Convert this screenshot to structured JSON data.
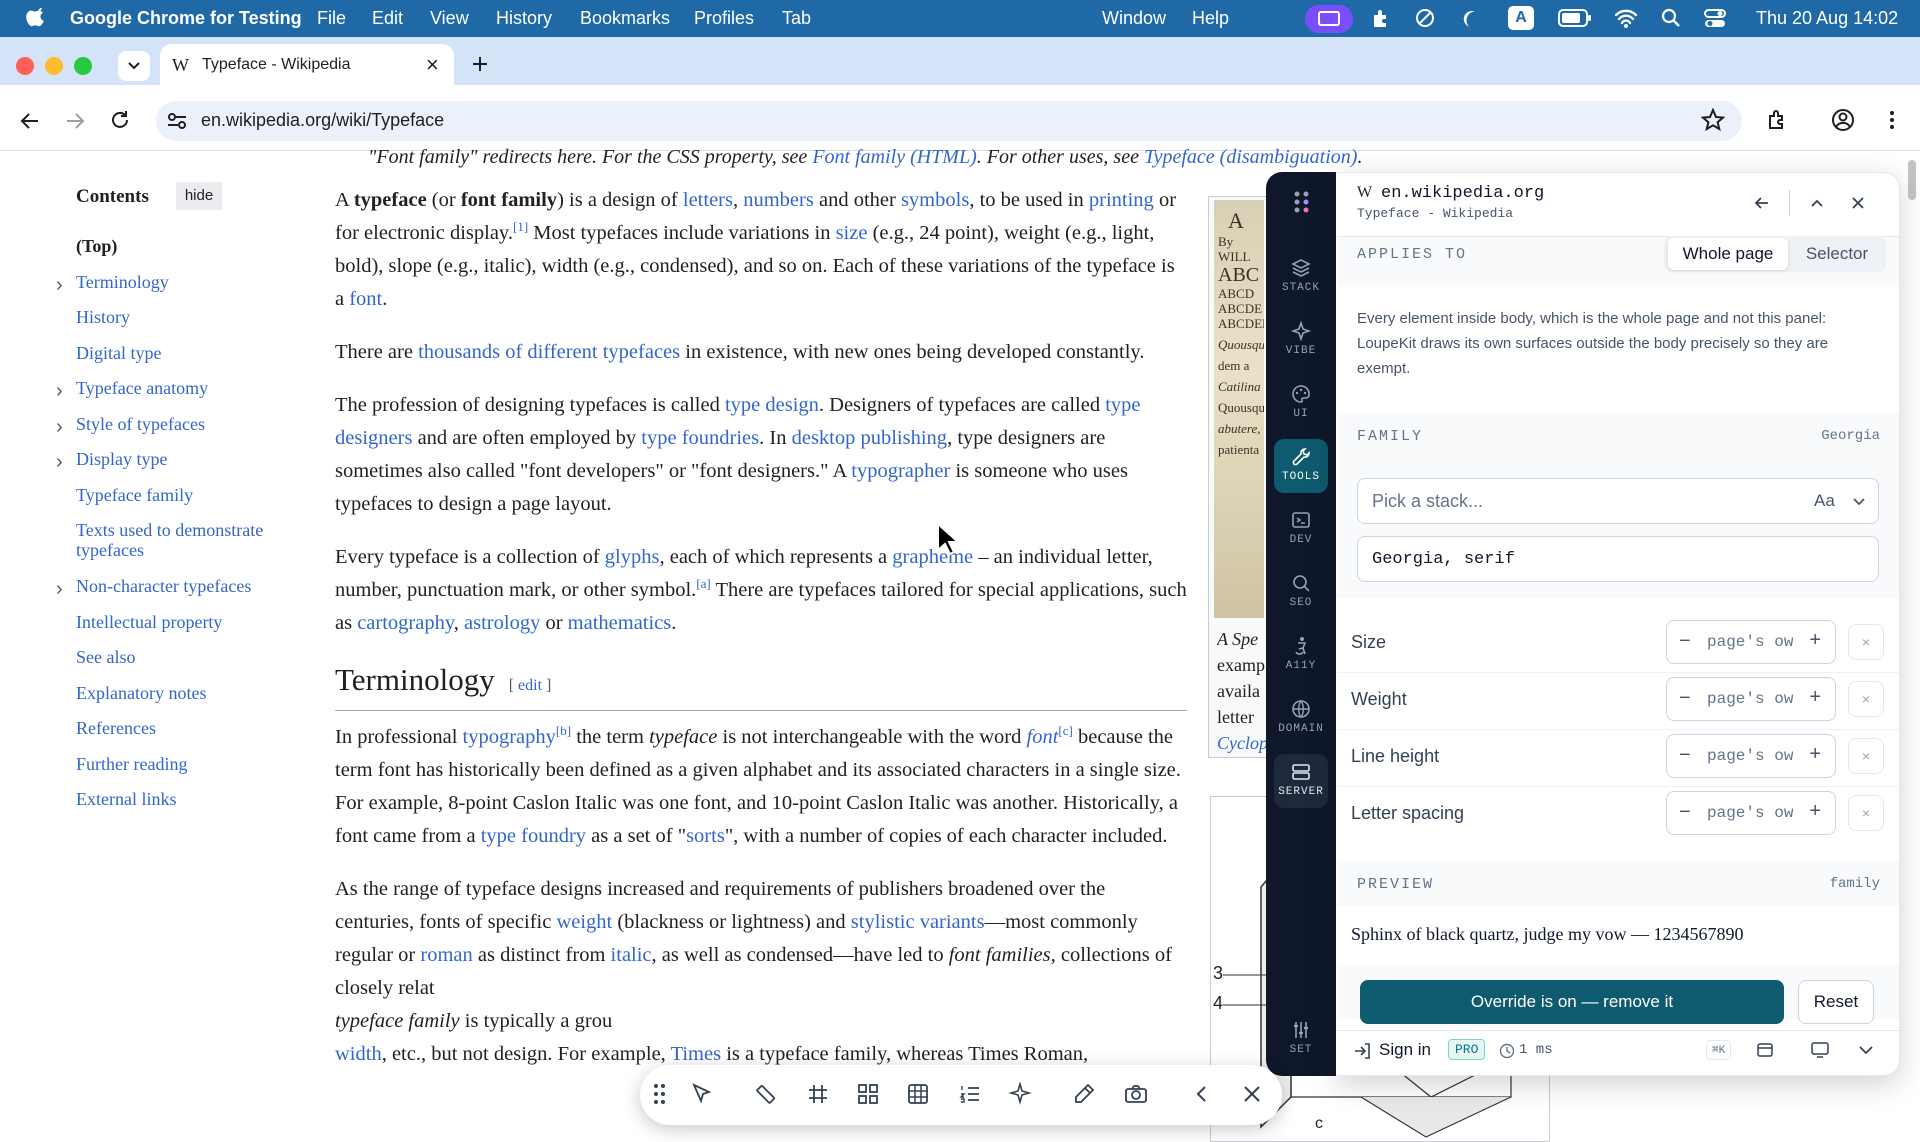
{
  "menubar": {
    "app_name": "Google Chrome for Testing",
    "items": [
      "File",
      "Edit",
      "View",
      "History",
      "Bookmarks",
      "Profiles",
      "Tab",
      "Window",
      "Help"
    ],
    "datetime": "Thu 20 Aug  14:02",
    "status_icons": [
      "screen-mirroring-icon",
      "extension-icon",
      "focus-icon",
      "moon-icon",
      "input-source-icon",
      "battery-icon",
      "wifi-icon",
      "spotlight-icon",
      "control-center-icon"
    ],
    "input_source": "A"
  },
  "tab": {
    "favicon": "W",
    "title": "Typeface - Wikipedia",
    "close": "×"
  },
  "toolbar": {
    "url": "en.wikipedia.org/wiki/Typeface"
  },
  "wiki": {
    "hatnote": {
      "prefix": "\"Font family\" redirects here. For the CSS property, see ",
      "link1": "Font family (HTML)",
      "middle": ". For other uses, see ",
      "link2": "Typeface (disambiguation)",
      "suffix": "."
    },
    "toc": {
      "title": "Contents",
      "hide": "hide",
      "items": [
        {
          "label": "(Top)",
          "top": true
        },
        {
          "label": "Terminology",
          "expand": true
        },
        {
          "label": "History"
        },
        {
          "label": "Digital type"
        },
        {
          "label": "Typeface anatomy",
          "expand": true
        },
        {
          "label": "Style of typefaces",
          "expand": true
        },
        {
          "label": "Display type",
          "expand": true
        },
        {
          "label": "Typeface family"
        },
        {
          "label": "Texts used to demonstrate typefaces"
        },
        {
          "label": "Non-character typefaces",
          "expand": true
        },
        {
          "label": "Intellectual property"
        },
        {
          "label": "See also"
        },
        {
          "label": "Explanatory notes"
        },
        {
          "label": "References"
        },
        {
          "label": "Further reading"
        },
        {
          "label": "External links"
        }
      ]
    },
    "p1": {
      "t1": "A ",
      "b1": "typeface",
      "t2": " (or ",
      "b2": "font family",
      "t3": ") is a design of ",
      "l1": "letters",
      "t4": ", ",
      "l2": "numbers",
      "t5": " and other ",
      "l3": "symbols",
      "t6": ", to be used in ",
      "l4": "printing",
      "t7": " or for electronic display.",
      "s1": "[1]",
      "t8": " Most typefaces include variations in ",
      "l5": "size",
      "t9": " (e.g., 24 point), weight (e.g., light, bold), slope (e.g., italic), width (e.g., condensed), and so on. Each of these variations of the typeface is a ",
      "l6": "font",
      "t10": "."
    },
    "p2": {
      "t1": "There are ",
      "l1": "thousands of different typefaces",
      "t2": " in existence, with new ones being developed constantly."
    },
    "p3": {
      "t1": "The profession of designing typefaces is called ",
      "l1": "type design",
      "t2": ". Designers of typefaces are called ",
      "l2": "type designers",
      "t3": " and are often employed by ",
      "l3": "type foundries",
      "t4": ". In ",
      "l4": "desktop publishing",
      "t5": ", type designers are sometimes also called \"font developers\" or \"font designers.\" A ",
      "l5": "typographer",
      "t6": " is someone who uses typefaces to design a page layout."
    },
    "p4": {
      "t1": "Every typeface is a collection of ",
      "l1": "glyphs",
      "t2": ", each of which represents a ",
      "l2": "grapheme",
      "t3": " – an individual letter, number, punctuation mark, or other symbol.",
      "s1": "[a]",
      "t4": " There are typefaces tailored for special applications, such as ",
      "l3": "cartography",
      "t5": ", ",
      "l4": "astrology",
      "t6": " or ",
      "l5": "mathematics",
      "t7": "."
    },
    "h2": {
      "title": "Terminology",
      "edit_open": "[ ",
      "edit": "edit",
      "edit_close": " ]"
    },
    "p5": {
      "t1": "In professional ",
      "l1": "typography",
      "s1": "[b]",
      "t2": " the term ",
      "i1": "typeface",
      "t3": " is not interchangeable with the word ",
      "l2": "font",
      "s2": "[c]",
      "t4": " because the term font has historically been defined as a given alphabet and its associated characters in a single size. For example, 8-point Caslon Italic was one font, and 10-point Caslon Italic was another. Historically, a font came from a ",
      "l3": "type foundry",
      "t5": " as a set of \"",
      "l4": "sorts",
      "t6": "\", with a number of copies of each character included."
    },
    "p6": {
      "t1": "As the range of typeface designs increased and requirements of publishers broadened over the centuries, fonts of specific ",
      "l1": "weight",
      "t2": " (blackness or lightness) and ",
      "l2": "stylistic variants",
      "t3": "—most commonly regular or ",
      "l3": "roman",
      "t4": " as distinct from ",
      "l4": "italic",
      "t5": ", as well as condensed—have led to ",
      "i1": "font families",
      "t6": ", collections of closely relat",
      "t7": "",
      "i2": "typeface family",
      "t8": " is typically a grou",
      "l5": "width",
      "t9": ", etc., but not design. For example, ",
      "l6": "Times",
      "t10": " is a typeface family, whereas Times Roman,"
    },
    "infobox_caption": [
      "A Spe",
      "examp",
      "availa",
      "letter",
      "Cyclop"
    ],
    "infobox_img_text": [
      "A",
      "By WILL",
      "ABC",
      "ABCD",
      "ABCDE",
      "ABCDEF",
      "Quousque",
      "dem a",
      "Catilina",
      "Quousque",
      "abutere,",
      "patienta"
    ],
    "diagram_labels": [
      "3",
      "4",
      "c"
    ]
  },
  "panel": {
    "rail": [
      {
        "label": "STACK",
        "icon": "stack-icon"
      },
      {
        "label": "VIBE",
        "icon": "sparkle-icon"
      },
      {
        "label": "UI",
        "icon": "palette-icon"
      },
      {
        "label": "TOOLS",
        "icon": "wrench-icon",
        "active": true
      },
      {
        "label": "DEV",
        "icon": "terminal-icon"
      },
      {
        "label": "SEO",
        "icon": "magnifier-icon"
      },
      {
        "label": "A11Y",
        "icon": "accessibility-icon"
      },
      {
        "label": "DOMAIN",
        "icon": "globe-icon"
      },
      {
        "label": "SERVER",
        "icon": "server-icon"
      },
      {
        "label": "SET",
        "icon": "sliders-icon"
      }
    ],
    "header": {
      "favicon": "W",
      "domain": "en.wikipedia.org",
      "title": "Typeface - Wikipedia"
    },
    "applies_to": {
      "label": "APPLIES TO",
      "options": [
        "Whole page",
        "Selector"
      ],
      "selected": "Whole page"
    },
    "description": "Every element inside body, which is the whole page and not this panel: LoupeKit draws its own surfaces outside the body precisely so they are exempt.",
    "family": {
      "label": "FAMILY",
      "value": "Georgia",
      "picker_placeholder": "Pick a stack...",
      "picker_aa": "Aa",
      "input_value": "Georgia, serif"
    },
    "rows": [
      {
        "label": "Size",
        "value": "page's ow"
      },
      {
        "label": "Weight",
        "value": "page's ow"
      },
      {
        "label": "Line height",
        "value": "page's ow"
      },
      {
        "label": "Letter spacing",
        "value": "page's ow"
      }
    ],
    "stepper_minus": "−",
    "stepper_plus": "+",
    "clear_glyph": "×",
    "preview": {
      "label": "PREVIEW",
      "right": "family",
      "text": "Sphinx of black quartz, judge my vow — 1234567890"
    },
    "override_button": "Override is on — remove it",
    "reset_button": "Reset",
    "footer": {
      "sign_in": "Sign in",
      "badge": "PRO",
      "timing": "1 ms",
      "shortcut": "⌘K"
    }
  },
  "colors": {
    "menubar": "#1f6aa6",
    "tabstrip": "#d5e3f8",
    "rail": "#0f172a",
    "accent": "#0e5a6e",
    "link": "#3366cc"
  }
}
